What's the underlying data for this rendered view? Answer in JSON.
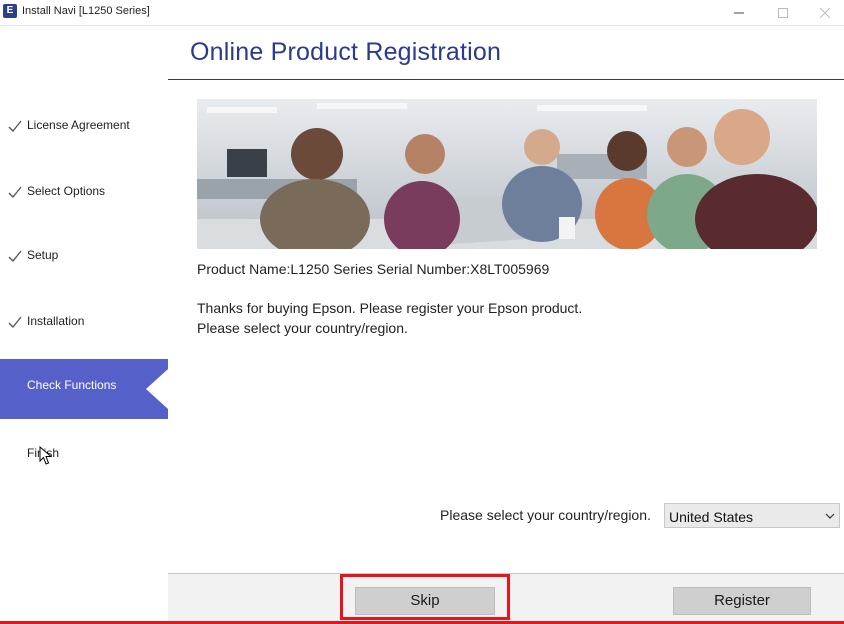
{
  "window": {
    "title": "Install Navi [L1250 Series]",
    "app_icon_letter": "E"
  },
  "sidebar": {
    "steps": [
      {
        "label": "License Agreement",
        "state": "done"
      },
      {
        "label": "Select Options",
        "state": "done"
      },
      {
        "label": "Setup",
        "state": "done"
      },
      {
        "label": "Installation",
        "state": "done"
      },
      {
        "label": "Check Functions",
        "state": "active"
      },
      {
        "label": "Finish",
        "state": "pending"
      }
    ]
  },
  "header": {
    "title": "Online Product Registration"
  },
  "content": {
    "product_line": "Product Name:L1250 Series Serial Number:X8LT005969",
    "message_1": "Thanks for buying Epson. Please register your Epson product.",
    "message_2": "Please select your country/region."
  },
  "country": {
    "label": "Please select your country/region.",
    "selected": "United States"
  },
  "buttons": {
    "skip": "Skip",
    "register": "Register"
  },
  "colors": {
    "accent": "#5561c9",
    "title": "#2a3a8c",
    "highlight": "#e8141b"
  }
}
